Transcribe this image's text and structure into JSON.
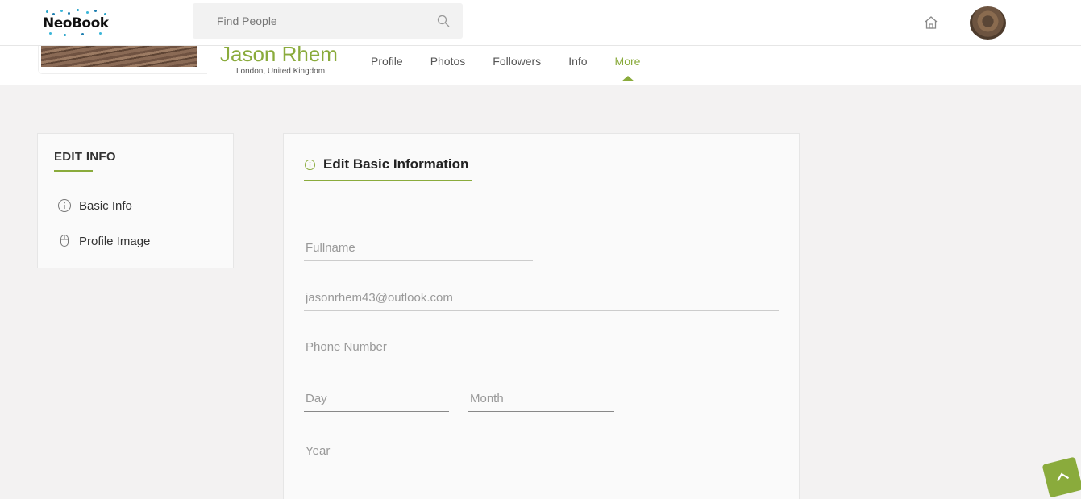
{
  "header": {
    "logo_text": "NeoBook",
    "search_placeholder": "Find People"
  },
  "profile": {
    "name": "Jason Rhem",
    "location": "London, United Kingdom",
    "tabs": [
      {
        "label": "Profile"
      },
      {
        "label": "Photos"
      },
      {
        "label": "Followers"
      },
      {
        "label": "Info"
      },
      {
        "label": "More",
        "active": true
      }
    ]
  },
  "sidebar": {
    "title": "EDIT INFO",
    "items": [
      {
        "label": "Basic Info",
        "icon": "info-icon"
      },
      {
        "label": "Profile Image",
        "icon": "mouse-icon"
      }
    ]
  },
  "form": {
    "title": "Edit Basic Information",
    "fullname_placeholder": "Fullname",
    "email_placeholder": "jasonrhem43@outlook.com",
    "phone_placeholder": "Phone Number",
    "day_placeholder": "Day",
    "month_placeholder": "Month",
    "year_placeholder": "Year"
  },
  "colors": {
    "accent": "#8aab3c",
    "background": "#f3f2f2"
  }
}
